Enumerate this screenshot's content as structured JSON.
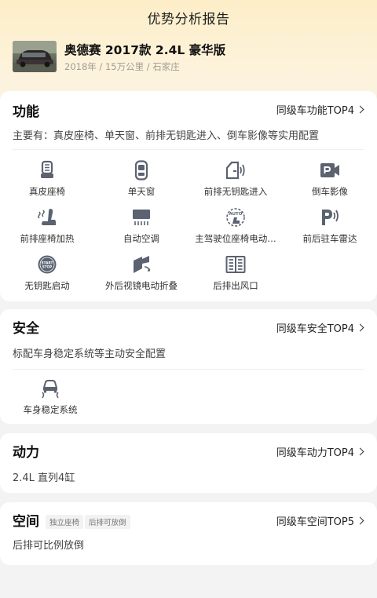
{
  "header": {
    "title": "优势分析报告"
  },
  "car": {
    "name": "奥德赛 2017款 2.4L 豪华版",
    "meta": "2018年 / 15万公里 / 石家庄",
    "thumb_icon": "car-photo"
  },
  "sections": {
    "function": {
      "title": "功能",
      "link": "同级车功能TOP4",
      "desc": "主要有：真皮座椅、单天窗、前排无钥匙进入、倒车影像等实用配置",
      "features": [
        {
          "label": "真皮座椅",
          "icon": "leather-seat-icon"
        },
        {
          "label": "单天窗",
          "icon": "sunroof-icon"
        },
        {
          "label": "前排无钥匙进入",
          "icon": "keyless-entry-icon"
        },
        {
          "label": "倒车影像",
          "icon": "reverse-camera-icon"
        },
        {
          "label": "前排座椅加热",
          "icon": "seat-heating-icon"
        },
        {
          "label": "自动空调",
          "icon": "auto-ac-icon"
        },
        {
          "label": "主驾驶位座椅电动…",
          "icon": "power-seat-icon"
        },
        {
          "label": "前后驻车雷达",
          "icon": "parking-radar-icon"
        },
        {
          "label": "无钥匙启动",
          "icon": "keyless-start-icon"
        },
        {
          "label": "外后视镜电动折叠",
          "icon": "mirror-fold-icon"
        },
        {
          "label": "后排出风口",
          "icon": "rear-vent-icon"
        }
      ]
    },
    "safety": {
      "title": "安全",
      "link": "同级车安全TOP4",
      "desc": "标配车身稳定系统等主动安全配置",
      "features": [
        {
          "label": "车身稳定系统",
          "icon": "stability-control-icon"
        }
      ]
    },
    "power": {
      "title": "动力",
      "link": "同级车动力TOP4",
      "desc": "2.4L 直列4缸"
    },
    "space": {
      "title": "空间",
      "tags": [
        "独立座椅",
        "后排可放倒"
      ],
      "link": "同级车空间TOP5",
      "desc": "后排可比例放倒"
    }
  },
  "colors": {
    "icon": "#5b6270",
    "hero_top": "#fdeec8",
    "card": "#ffffff",
    "background": "#f3f3f3"
  }
}
